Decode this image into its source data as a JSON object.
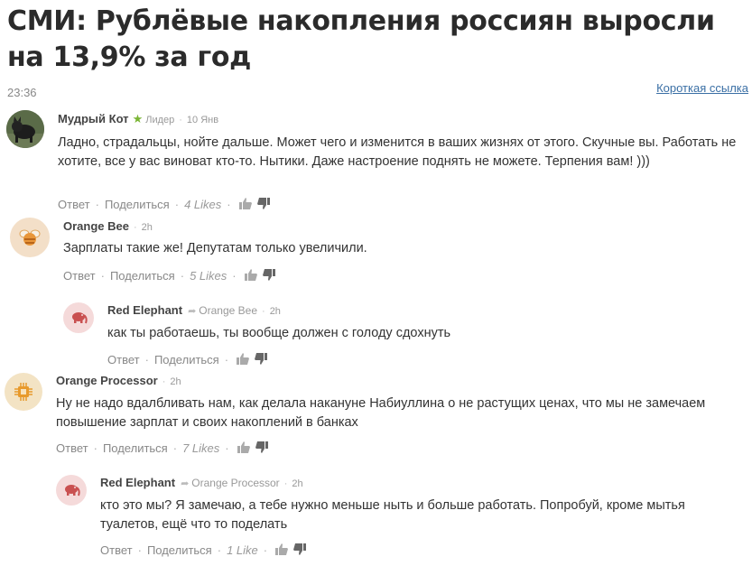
{
  "article": {
    "title": "СМИ: Рублёвые накопления россиян выросли на 13,9% за год",
    "time": "23:36",
    "short_link": "Короткая ссылка"
  },
  "comments": [
    {
      "author": "Мудрый Кот",
      "badge": "Лидер",
      "date": "10 Янв",
      "text": "Ладно, страдальцы, нойте дальше. Может чего и изменится в ваших жизнях от этого. Скучные вы. Работать не хотите, все у вас виноват кто-то. Нытики.  Даже настроение поднять не можете. Терпения вам! )))",
      "reply": "Ответ",
      "share": "Поделиться",
      "likes": "4 Likes"
    },
    {
      "author": "Orange Bee",
      "date": "2h",
      "text": "Зарплаты такие же! Депутатам только увеличили.",
      "reply": "Ответ",
      "share": "Поделиться",
      "likes": "5 Likes"
    },
    {
      "author": "Red Elephant",
      "reply_to": "Orange Bee",
      "date": "2h",
      "text": "как ты работаешь, ты вообще должен с голоду сдохнуть",
      "reply": "Ответ",
      "share": "Поделиться"
    },
    {
      "author": "Orange Processor",
      "date": "2h",
      "text": "Ну не надо вдалбливать нам, как делала накануне Набиуллина о не растущих ценах, что мы не замечаем повышение зарплат и своих накоплений в банках",
      "reply": "Ответ",
      "share": "Поделиться",
      "likes": "7 Likes"
    },
    {
      "author": "Red Elephant",
      "reply_to": "Orange Processor",
      "date": "2h",
      "text": "кто это мы? Я замечаю, а тебе нужно меньше ныть и больше работать. Попробуй, кроме мытья туалетов, ещё что то поделать",
      "reply": "Ответ",
      "share": "Поделиться",
      "likes": "1 Like"
    }
  ],
  "colors": {
    "link": "#3a6fa5",
    "leader_star": "#7ab534",
    "bee_avatar_bg": "#f3dfc8",
    "processor_avatar_bg": "#f3e3c4",
    "elephant_avatar_bg": "#f5dada"
  }
}
